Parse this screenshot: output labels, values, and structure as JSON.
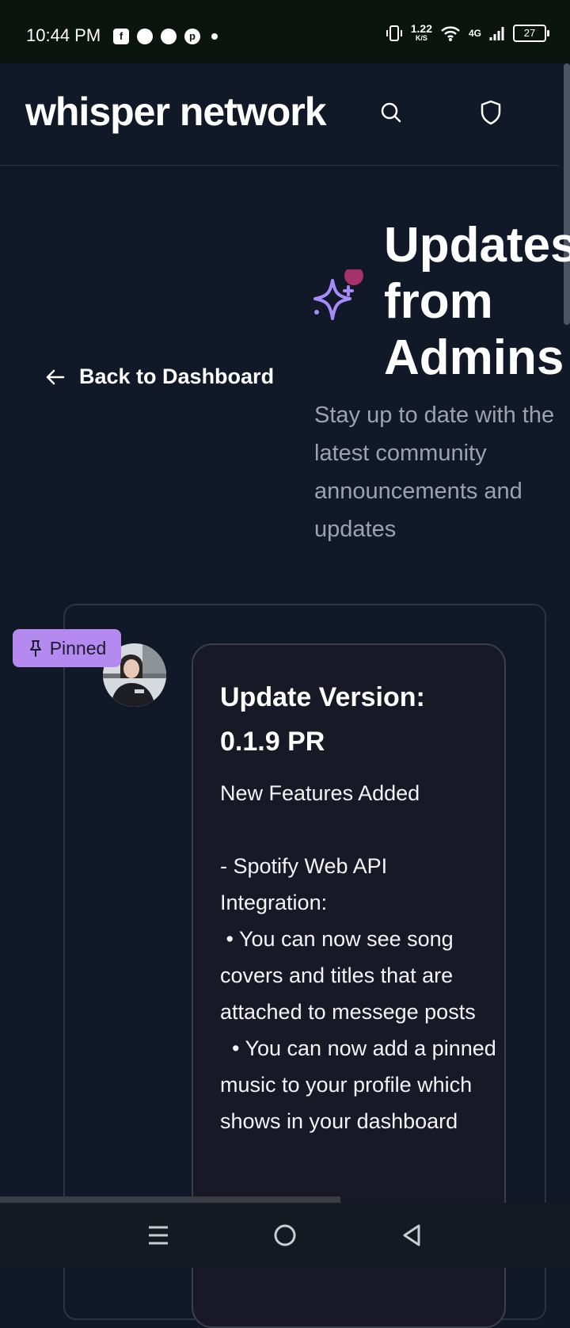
{
  "status_bar": {
    "time": "10:44 PM",
    "net_speed_value": "1.22",
    "net_speed_unit": "K/S",
    "network_type": "4G",
    "battery_level": "27",
    "icons": [
      "facebook-icon",
      "chat-icon",
      "messenger-icon",
      "pinterest-icon",
      "dot-icon",
      "vibrate-icon",
      "wifi-icon",
      "signal-icon",
      "battery-icon"
    ]
  },
  "app_bar": {
    "logo": "whisper network",
    "actions": [
      "search-icon",
      "shield-icon"
    ]
  },
  "page": {
    "back_label": "Back to Dashboard",
    "heading": "Updates from Admins",
    "subheading_lines": [
      "Stay up to date with the",
      "latest community",
      "announcements and",
      "updates"
    ]
  },
  "post": {
    "badge": "Pinned",
    "title": "Update Version: 0.1.9 PR",
    "body": "New Features Added\n\n- Spotify Web API Integration:\n • You can now see song covers and titles that are attached to messege posts\n  • You can now add a pinned music to your profile which shows in your dashboard"
  },
  "nav_bar": {
    "buttons": [
      "menu-icon",
      "home-icon",
      "back-icon"
    ]
  },
  "colors": {
    "background": "#111827",
    "accent": "#b48af0",
    "card": "#191827"
  }
}
